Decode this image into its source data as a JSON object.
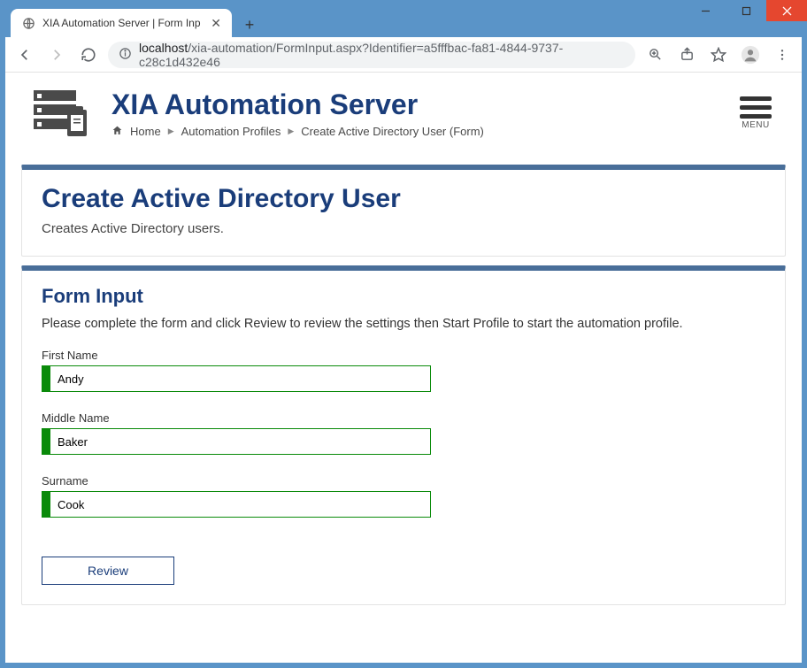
{
  "window": {
    "tab_title": "XIA Automation Server | Form Inp"
  },
  "url": {
    "host": "localhost",
    "path": "/xia-automation/FormInput.aspx?Identifier=a5fffbac-fa81-4844-9737-c28c1d432e46"
  },
  "app": {
    "title": "XIA Automation Server",
    "menu_label": "MENU"
  },
  "breadcrumbs": {
    "home": "Home",
    "profiles": "Automation Profiles",
    "current": "Create Active Directory User (Form)"
  },
  "panel1": {
    "heading": "Create Active Directory User",
    "desc": "Creates Active Directory users."
  },
  "panel2": {
    "heading": "Form Input",
    "desc": "Please complete the form and click Review to review the settings then Start Profile to start the automation profile."
  },
  "form": {
    "first_name_label": "First Name",
    "first_name_value": "Andy",
    "middle_name_label": "Middle Name",
    "middle_name_value": "Baker",
    "surname_label": "Surname",
    "surname_value": "Cook",
    "review_label": "Review"
  }
}
